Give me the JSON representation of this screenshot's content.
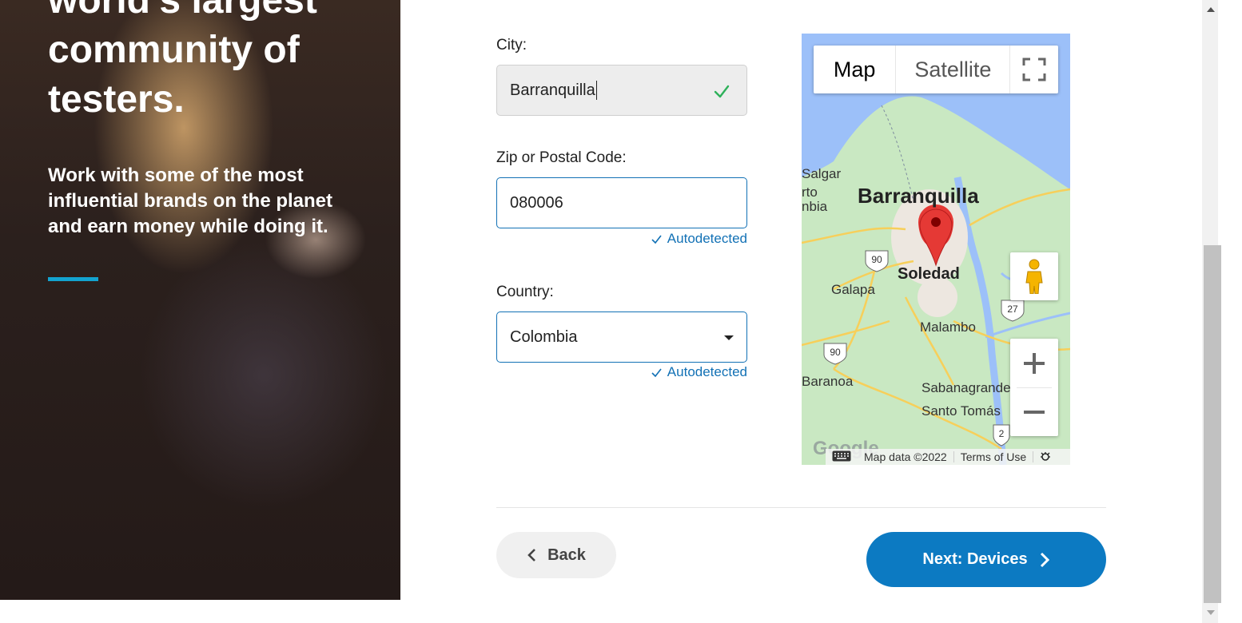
{
  "hero": {
    "title": "world's largest\ncommunity of\ntesters.",
    "subtitle": "Work with some of the most influential brands on the planet and earn money while doing it."
  },
  "form": {
    "city": {
      "label": "City:",
      "value": "Barranquilla",
      "valid": true
    },
    "zip": {
      "label": "Zip or Postal Code:",
      "value": "080006",
      "note": "Autodetected"
    },
    "country": {
      "label": "Country:",
      "value": "Colombia",
      "note": "Autodetected"
    }
  },
  "map": {
    "type_buttons": {
      "map": "Map",
      "satellite": "Satellite"
    },
    "places": {
      "barranquilla": "Barranquilla",
      "soledad": "Soledad",
      "galapa": "Galapa",
      "malambo": "Malambo",
      "baranoa": "Baranoa",
      "sabanagrande": "Sabanagrande",
      "santo_tomas": "Santo Tomás",
      "salgar": "Salgar",
      "puerto": "rto",
      "colombia_partial": "nbia"
    },
    "road_shields": {
      "r90a": "90",
      "r90b": "90",
      "r27": "27",
      "r2": "2"
    },
    "footer": {
      "logo": "Google",
      "data": "Map data ©2022",
      "terms": "Terms of Use"
    },
    "colors": {
      "land": "#c9e8c2",
      "water": "#9cc0f9",
      "road": "#f7cf5a",
      "pin": "#e53935"
    }
  },
  "nav": {
    "back": "Back",
    "next": "Next: Devices"
  },
  "colors": {
    "primary": "#0c7ac2",
    "accent": "#13a3cf",
    "valid": "#2eb15a"
  }
}
